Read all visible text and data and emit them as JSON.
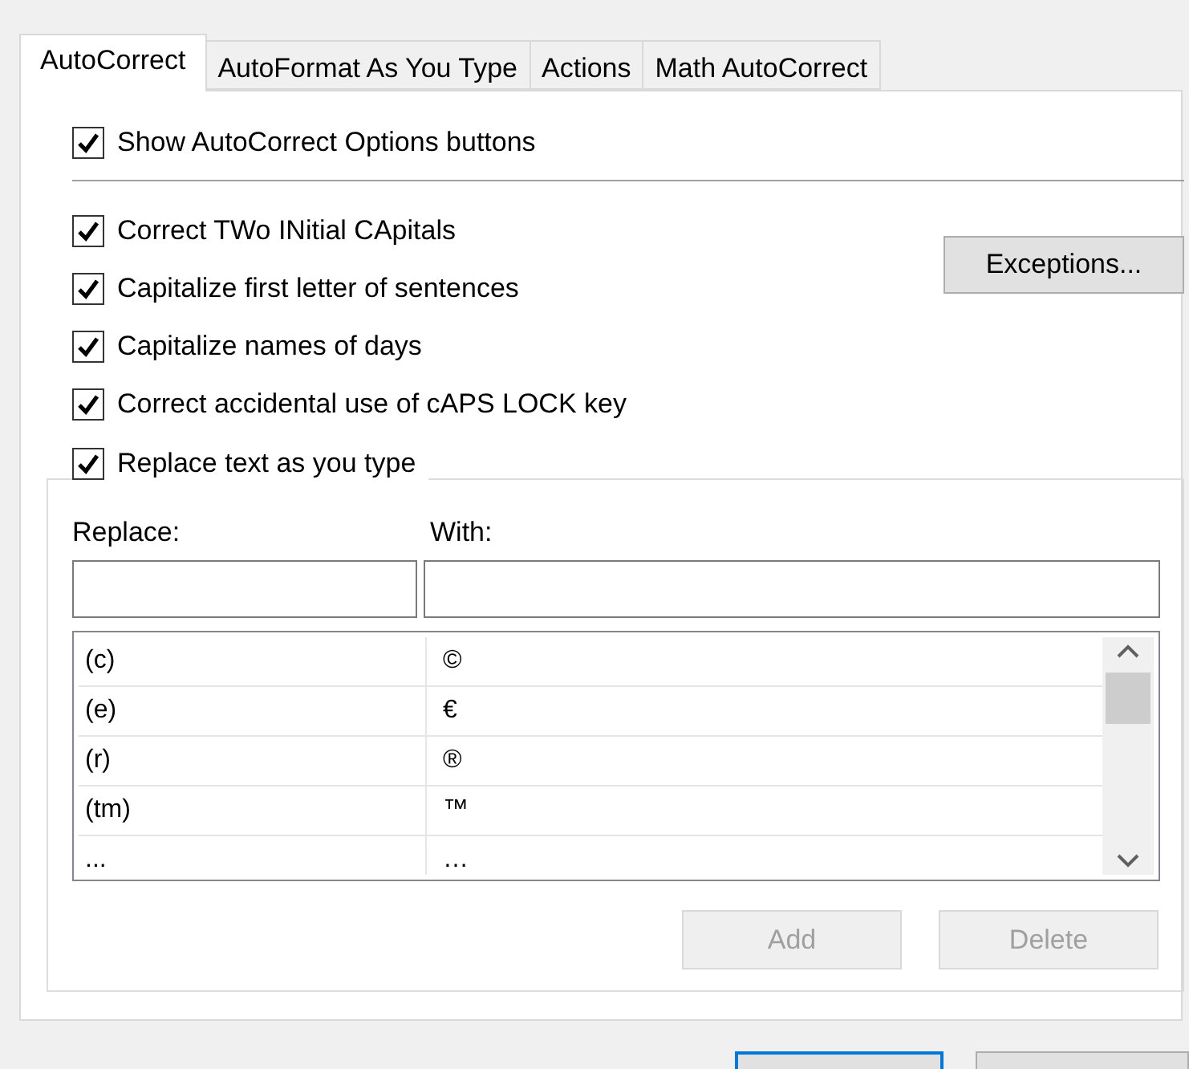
{
  "tabs": [
    {
      "label": "AutoCorrect",
      "selected": true
    },
    {
      "label": "AutoFormat As You Type",
      "selected": false
    },
    {
      "label": "Actions",
      "selected": false
    },
    {
      "label": "Math AutoCorrect",
      "selected": false
    }
  ],
  "show_options": {
    "label": "Show AutoCorrect Options buttons",
    "checked": true
  },
  "options": [
    {
      "label": "Correct TWo INitial CApitals",
      "checked": true
    },
    {
      "label": "Capitalize first letter of sentences",
      "checked": true
    },
    {
      "label": "Capitalize names of days",
      "checked": true
    },
    {
      "label": "Correct accidental use of cAPS LOCK key",
      "checked": true
    }
  ],
  "exceptions_button": "Exceptions...",
  "replace_group": {
    "label": "Replace text as you type",
    "checked": true
  },
  "replace_label": "Replace:",
  "with_label": "With:",
  "entries": [
    {
      "replace": "(c)",
      "with": "©"
    },
    {
      "replace": "(e)",
      "with": "€"
    },
    {
      "replace": "(r)",
      "with": "®"
    },
    {
      "replace": "(tm)",
      "with": "™"
    },
    {
      "replace": "...",
      "with": "…"
    }
  ],
  "buttons": [
    {
      "label": "Add",
      "disabled": true
    },
    {
      "label": "Delete",
      "disabled": true
    }
  ]
}
